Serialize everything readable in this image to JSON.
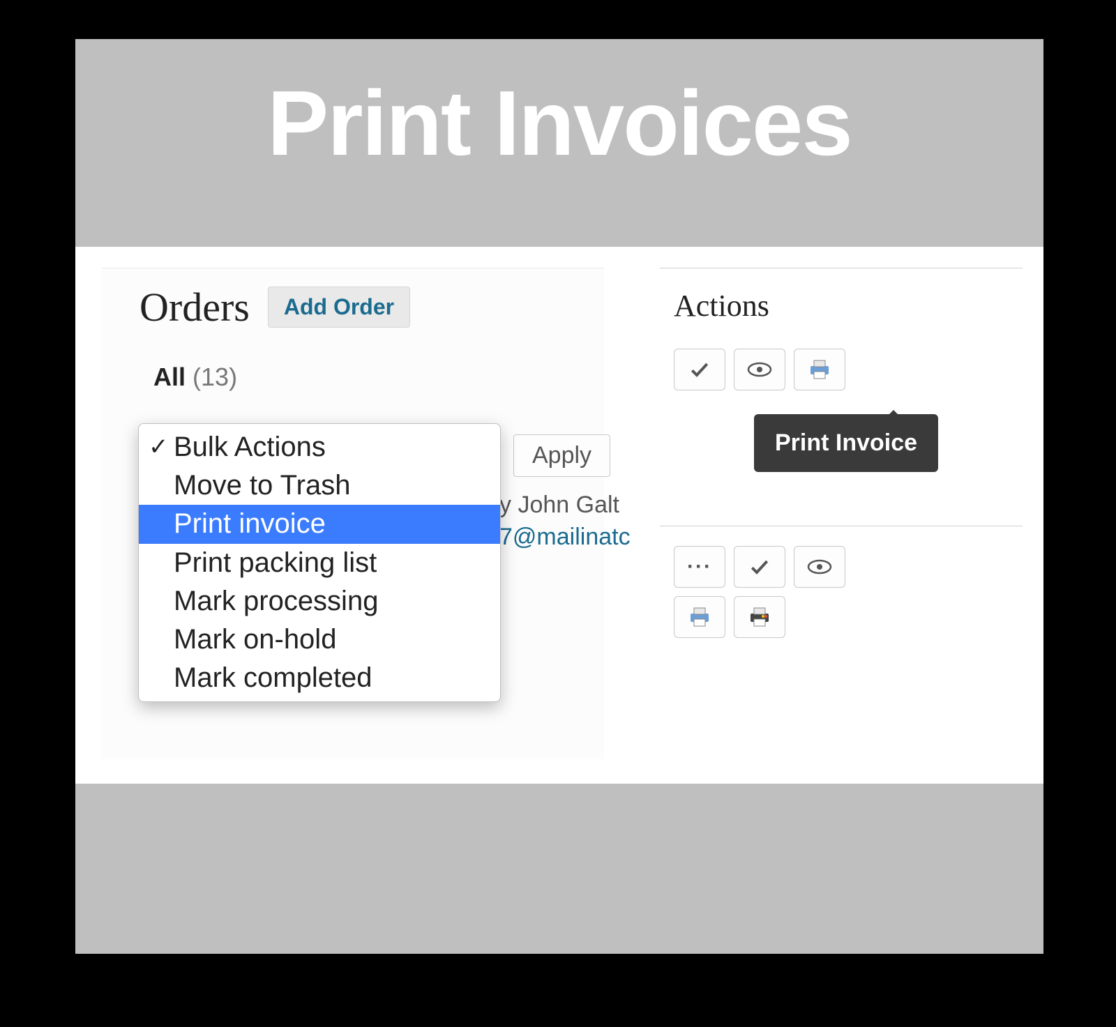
{
  "banner": {
    "title": "Print Invoices"
  },
  "left": {
    "title": "Orders",
    "add_order": "Add Order",
    "filter_label": "All",
    "filter_count": "(13)",
    "apply": "Apply",
    "row_name_fragment": "y John Galt",
    "row_email_fragment": "7@mailinatc"
  },
  "dropdown": {
    "items": [
      {
        "label": "Bulk Actions",
        "checked": true,
        "highlighted": false
      },
      {
        "label": "Move to Trash",
        "checked": false,
        "highlighted": false
      },
      {
        "label": "Print invoice",
        "checked": false,
        "highlighted": true
      },
      {
        "label": "Print packing list",
        "checked": false,
        "highlighted": false
      },
      {
        "label": "Mark processing",
        "checked": false,
        "highlighted": false
      },
      {
        "label": "Mark on-hold",
        "checked": false,
        "highlighted": false
      },
      {
        "label": "Mark completed",
        "checked": false,
        "highlighted": false
      }
    ]
  },
  "right": {
    "title": "Actions",
    "tooltip": "Print Invoice"
  },
  "icons": {
    "check": "check-icon",
    "eye": "eye-icon",
    "printer": "printer-icon",
    "dots": "more-icon",
    "printer_color": "printer-color-icon"
  }
}
